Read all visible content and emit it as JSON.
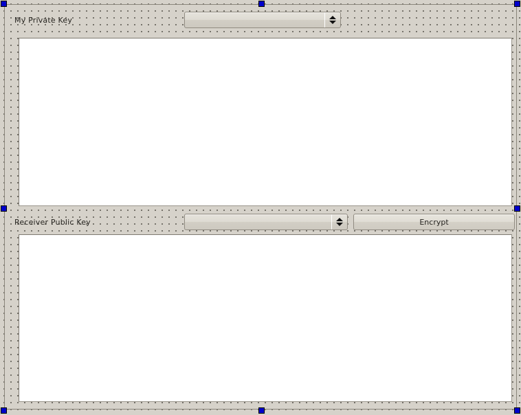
{
  "app": {
    "window_title": "Form Designer",
    "canvas_background": "#d6d2ca",
    "grid_dot_color": "#5d5a52",
    "selection_handle_color": "#0000cc",
    "text_color": "#25231f"
  },
  "form": {
    "private_key_section": {
      "label": "My Private Key",
      "combo": {
        "selected_value": "",
        "placeholder": "",
        "up_arrow_icon": "triangle-up-icon",
        "down_arrow_icon": "triangle-down-icon"
      },
      "textarea": {
        "value": "",
        "placeholder": ""
      }
    },
    "public_key_section": {
      "label": "Receiver Public Key",
      "combo": {
        "selected_value": "",
        "placeholder": "",
        "up_arrow_icon": "triangle-up-icon",
        "down_arrow_icon": "triangle-down-icon"
      },
      "encrypt_button_label": "Encrypt",
      "textarea": {
        "value": "",
        "placeholder": ""
      }
    }
  },
  "selection": {
    "handles": [
      "top-left",
      "top-center",
      "top-right",
      "middle-left",
      "middle-right",
      "bottom-left",
      "bottom-center",
      "bottom-right"
    ]
  }
}
